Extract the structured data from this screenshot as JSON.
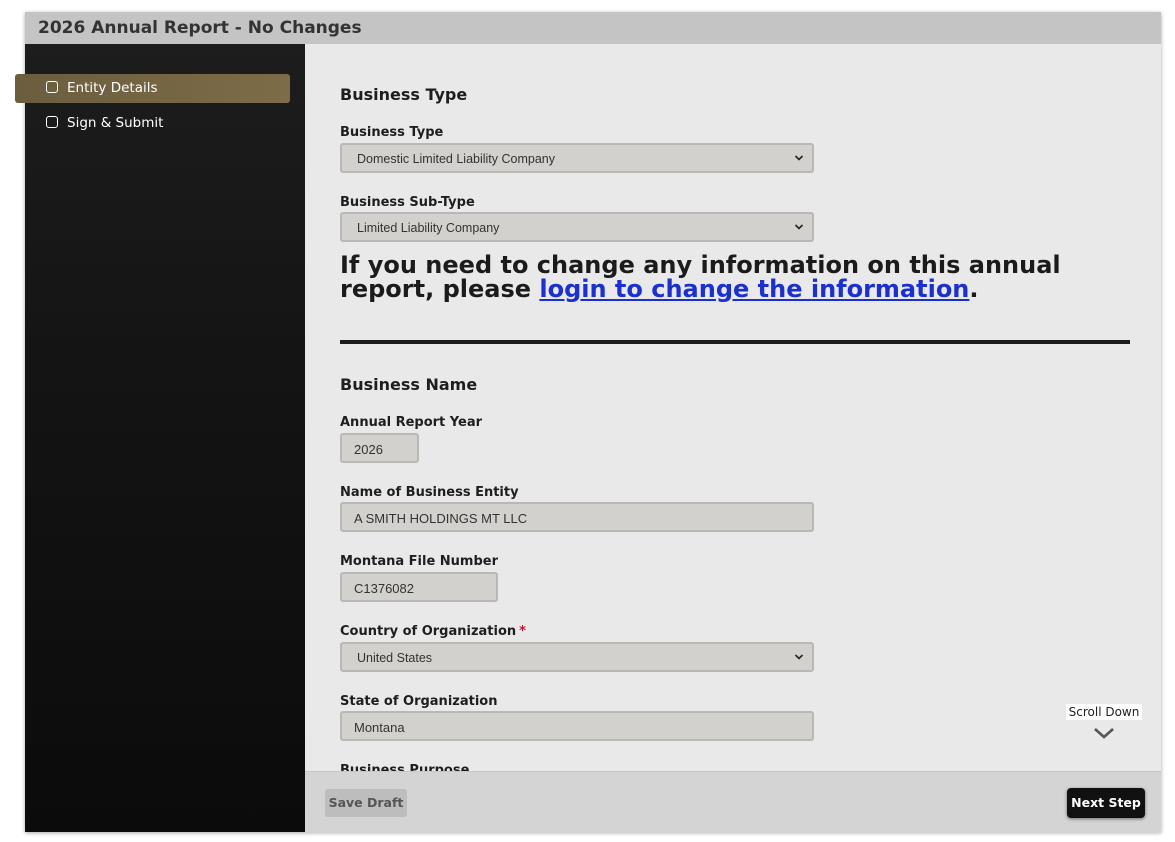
{
  "window": {
    "title": "2026 Annual Report - No Changes"
  },
  "sidebar": {
    "items": [
      {
        "label": "Entity Details",
        "active": true,
        "icon": "checkbox-icon"
      },
      {
        "label": "Sign & Submit",
        "active": false,
        "icon": "checkbox-icon"
      }
    ]
  },
  "business_type_section": {
    "heading": "Business Type",
    "business_type": {
      "label": "Business Type",
      "value": "Domestic Limited Liability Company"
    },
    "business_sub_type": {
      "label": "Business Sub-Type",
      "value": "Limited Liability Company"
    }
  },
  "notice": {
    "text_before": "If you need to change any information on this annual report, please ",
    "link_text": "login to change the information",
    "text_after": "."
  },
  "business_name_section": {
    "heading": "Business Name",
    "annual_report_year": {
      "label": "Annual Report Year",
      "value": "2026"
    },
    "name_of_business_entity": {
      "label": "Name of Business Entity",
      "value": "A SMITH HOLDINGS MT LLC"
    },
    "montana_file_number": {
      "label": "Montana File Number",
      "value": "C1376082"
    },
    "country_of_organization": {
      "label": "Country of Organization",
      "required_marker": "*",
      "value": "United States"
    },
    "state_of_organization": {
      "label": "State of Organization",
      "value": "Montana"
    },
    "business_purpose": {
      "label": "Business Purpose"
    }
  },
  "scroll_hint": {
    "label": "Scroll Down",
    "icon": "chevron-down-icon"
  },
  "footer": {
    "save_draft_label": "Save Draft",
    "next_step_label": "Next Step"
  },
  "colors": {
    "sidebar_active": "#7d6c47",
    "link": "#1a2fd6",
    "required": "#c8102e",
    "primary_button": "#111111"
  }
}
